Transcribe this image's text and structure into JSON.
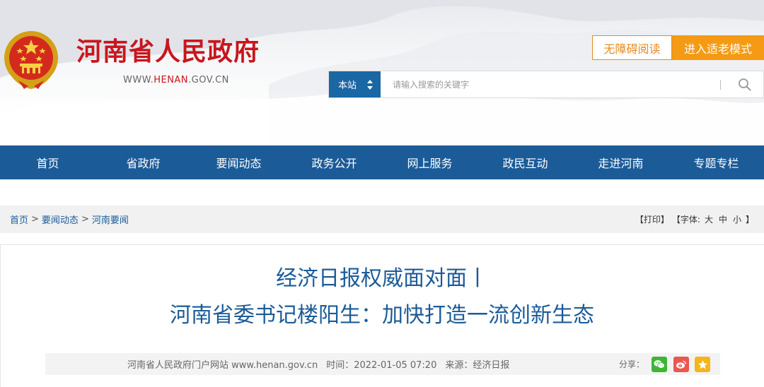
{
  "header": {
    "site_title": "河南省人民政府",
    "site_url_prefix": "WWW.",
    "site_url_highlight": "HENAN",
    "site_url_suffix": ".GOV.CN",
    "accessibility_label": "无障碍阅读",
    "elder_mode_label": "进入适老模式",
    "brand_color": "#c8161d",
    "accent_color": "#f49a14"
  },
  "search": {
    "scope_label": "本站",
    "placeholder": "请输入搜索的关键字",
    "icon": "search-icon"
  },
  "nav": {
    "items": [
      "首页",
      "省政府",
      "要闻动态",
      "政务公开",
      "网上服务",
      "政民互动",
      "走进河南",
      "专题专栏"
    ],
    "color": "#1b5b98"
  },
  "breadcrumb": {
    "items": [
      "首页",
      "要闻动态",
      "河南要闻"
    ],
    "separator": ">"
  },
  "tools": {
    "print_label": "【打印】",
    "font_label_open": "【字体:",
    "size_large": "大",
    "size_medium": "中",
    "size_small": "小",
    "font_label_close": "】"
  },
  "article": {
    "title_line1": "经济日报权威面对面丨",
    "title_line2": "河南省委书记楼阳生：加快打造一流创新生态",
    "meta_site": "河南省人民政府门户网站 www.henan.gov.cn",
    "meta_time": "时间：2022-01-05 07:20",
    "meta_source": "来源：经济日报",
    "share_label": "分享：",
    "share_icons": [
      "wechat-icon",
      "weibo-icon",
      "qzone-icon"
    ]
  }
}
